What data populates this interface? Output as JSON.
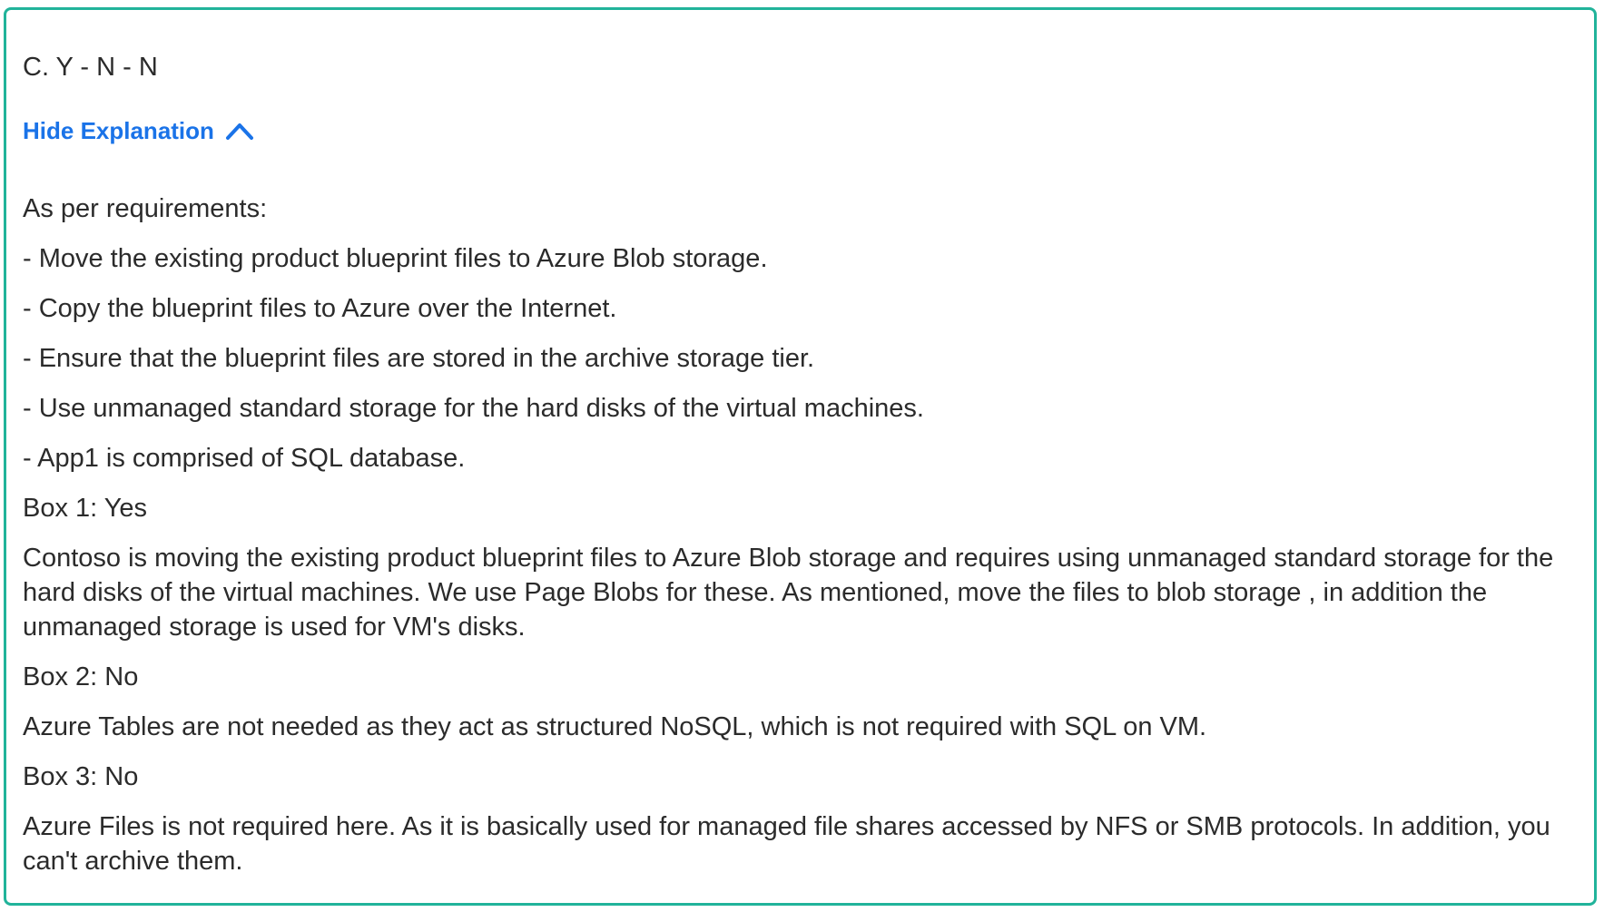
{
  "answer": {
    "text": "C. Y - N - N"
  },
  "toggle": {
    "label": "Hide Explanation",
    "icon": "chevron-up-icon",
    "color": "#1a73e8"
  },
  "explanation": {
    "intro": "As per requirements:",
    "requirements": [
      "- Move the existing product blueprint files to Azure Blob storage.",
      "- Copy the blueprint files to Azure over the Internet.",
      "- Ensure that the blueprint files are stored in the archive storage tier.",
      "- Use unmanaged standard storage for the hard disks of the virtual machines.",
      "- App1 is comprised of SQL database."
    ],
    "box1_heading": "Box 1: Yes",
    "box1_text": "Contoso is moving the existing product blueprint files to Azure Blob storage and requires using unmanaged standard storage for the hard disks of the virtual machines. We use Page Blobs for these. As mentioned, move the files to blob storage , in addition the unmanaged storage is used for VM's disks.",
    "box2_heading": "Box 2: No",
    "box2_text": "Azure Tables are not needed as they act as structured NoSQL, which is not required with SQL on VM.",
    "box3_heading": "Box 3: No",
    "box3_text": "Azure Files is not required here. As it is basically used for managed file shares accessed by NFS or SMB protocols. In addition, you can't archive them."
  },
  "colors": {
    "border": "#21b39a",
    "text": "#2b2b2b",
    "link": "#1a73e8"
  }
}
